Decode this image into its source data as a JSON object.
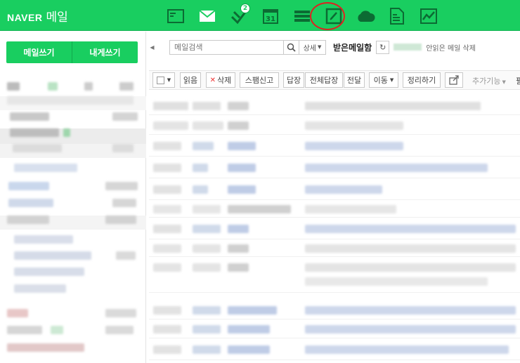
{
  "brand": {
    "naver": "NAVER",
    "mail": "메일"
  },
  "apps": [
    {
      "name": "address-book-icon"
    },
    {
      "name": "mail-icon"
    },
    {
      "name": "task-icon",
      "badge": "2"
    },
    {
      "name": "calendar-icon",
      "day": "31"
    },
    {
      "name": "memo-list-icon"
    },
    {
      "name": "note-edit-icon"
    },
    {
      "name": "cloud-icon"
    },
    {
      "name": "document-icon"
    },
    {
      "name": "chart-icon"
    }
  ],
  "sidebar": {
    "compose": "메일쓰기",
    "self_compose": "내게쓰기"
  },
  "search": {
    "placeholder": "메일검색",
    "detail": "상세"
  },
  "folder": {
    "title": "받은메일함",
    "unread_delete": "안읽은 메일 삭제"
  },
  "toolbar": {
    "read": "읽음",
    "delete": "삭제",
    "spam": "스팸신고",
    "reply": "답장",
    "reply_all": "전체답장",
    "forward": "전달",
    "move": "이동",
    "organize": "정리하기",
    "more": "추가기능",
    "overflow": "필"
  },
  "colors": {
    "brand_green": "#19ce60",
    "highlight_red": "#e02020"
  }
}
